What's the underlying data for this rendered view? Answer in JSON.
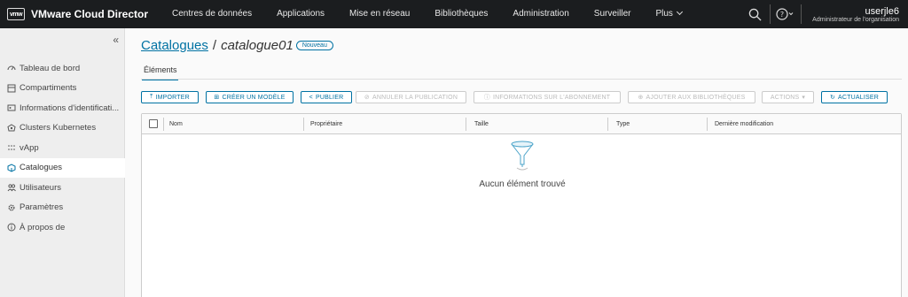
{
  "topnav": {
    "logo_text": "vmw",
    "app_title": "VMware Cloud Director",
    "links": [
      "Centres de données",
      "Applications",
      "Mise en réseau",
      "Bibliothèques",
      "Administration",
      "Surveiller",
      "Plus"
    ],
    "user_name": "userjle6",
    "user_role": "Administrateur de l'organisation"
  },
  "sidebar": {
    "collapse_glyph": "«",
    "items": [
      {
        "label": "Tableau de bord",
        "icon": "dashboard-icon"
      },
      {
        "label": "Compartiments",
        "icon": "compartment-icon"
      },
      {
        "label": "Informations d'identificati...",
        "icon": "id-card-icon"
      },
      {
        "label": "Clusters Kubernetes",
        "icon": "kubernetes-icon"
      },
      {
        "label": "vApp",
        "icon": "vapp-icon"
      },
      {
        "label": "Catalogues",
        "icon": "catalog-icon"
      },
      {
        "label": "Utilisateurs",
        "icon": "users-icon"
      },
      {
        "label": "Paramètres",
        "icon": "gear-icon"
      },
      {
        "label": "À propos de",
        "icon": "info-icon"
      }
    ],
    "active_index": 5
  },
  "breadcrumb": {
    "parent": "Catalogues",
    "separator": "/",
    "current": "catalogue01",
    "badge": "Nouveau"
  },
  "tabs": [
    "Éléments"
  ],
  "toolbar": {
    "import": "IMPORTER",
    "create_template": "CRÉER UN MODÈLE",
    "publish": "PUBLIER",
    "unpublish": "ANNULER LA PUBLICATION",
    "subscription_info": "INFORMATIONS SUR L'ABONNEMENT",
    "add_to_libraries": "AJOUTER AUX BIBLIOTHÈQUES",
    "actions": "ACTIONS",
    "refresh": "ACTUALISER"
  },
  "grid": {
    "columns": [
      "Nom",
      "Propriétaire",
      "Taille",
      "Type",
      "Dernière modification"
    ],
    "empty_text": "Aucun élément trouvé"
  },
  "colors": {
    "nav_bg": "#1b1d1f",
    "accent": "#0072a3",
    "sidebar_bg": "#eeeeee"
  }
}
